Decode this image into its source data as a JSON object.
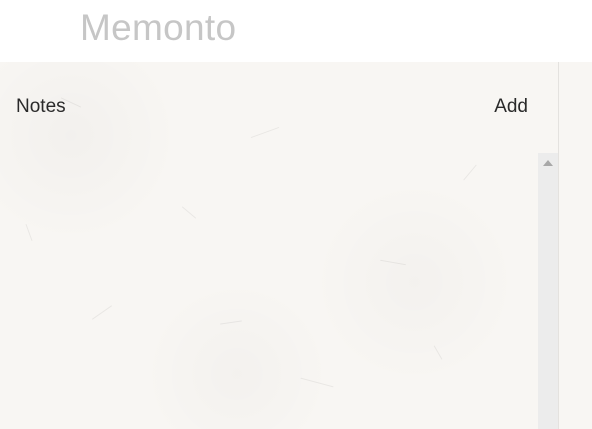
{
  "app": {
    "title": "Memonto"
  },
  "notes_pane": {
    "title": "Notes",
    "add_label": "Add",
    "items": []
  },
  "icons": {
    "scroll_up": "triangle-up-icon"
  },
  "colors": {
    "title": "#c6c6c6",
    "paper": "#f8f6f3",
    "text": "#2a2a2a",
    "scrollbar_track": "#ececec",
    "scroll_arrow": "#a8a8a8"
  }
}
